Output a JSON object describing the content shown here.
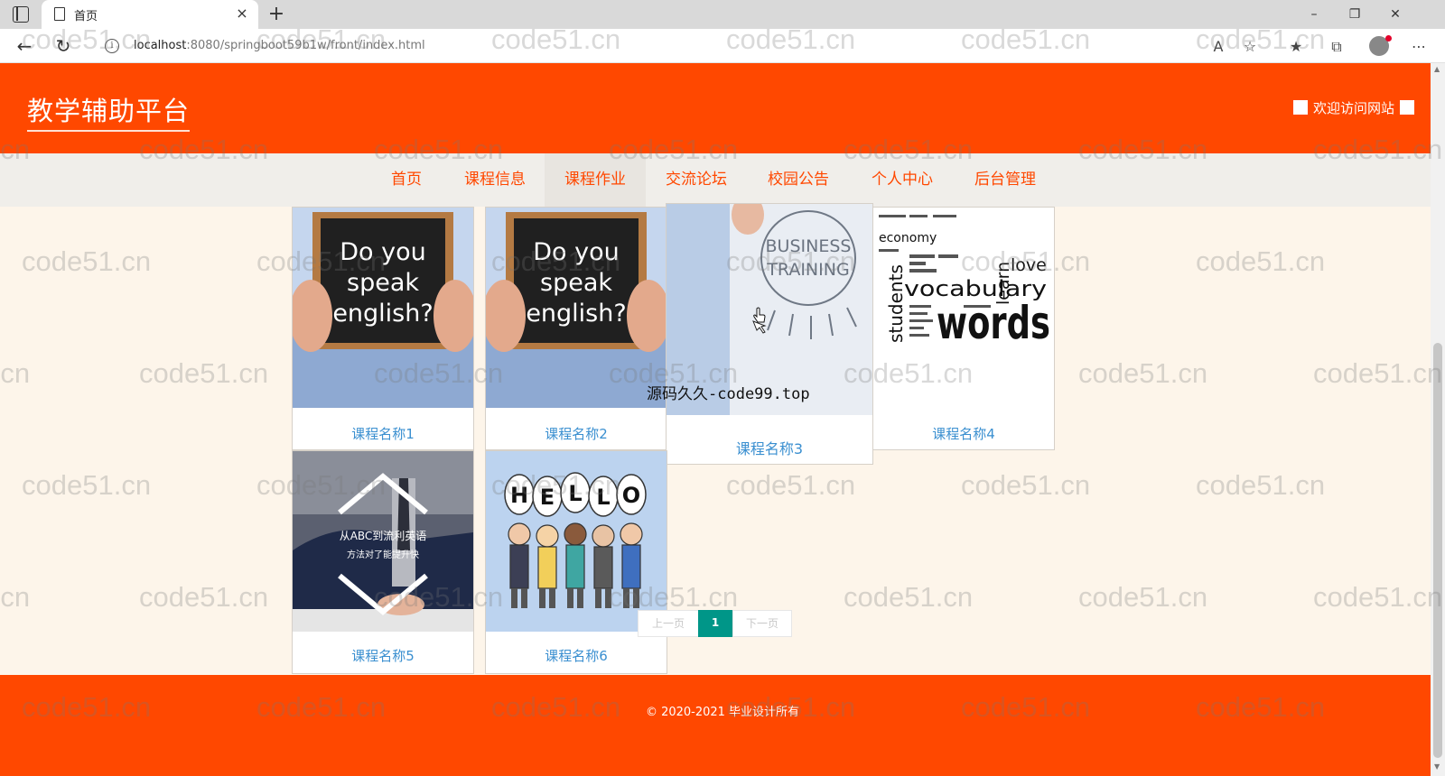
{
  "browser": {
    "tab_title": "首页",
    "tab_close": "×",
    "new_tab": "+",
    "url_host": "localhost",
    "url_rest": ":8080/springboot59b1w/front/index.html",
    "controls": {
      "minimize": "–",
      "restore": "❐",
      "close": "✕"
    }
  },
  "header": {
    "site_title": "教学辅助平台",
    "welcome": "欢迎访问网站"
  },
  "nav": {
    "items": [
      {
        "label": "首页"
      },
      {
        "label": "课程信息"
      },
      {
        "label": "课程作业"
      },
      {
        "label": "交流论坛"
      },
      {
        "label": "校园公告"
      },
      {
        "label": "个人中心"
      },
      {
        "label": "后台管理"
      }
    ],
    "active_index": 2
  },
  "courses": [
    {
      "name": "课程名称1",
      "image": "chalkboard-do-you-speak-english",
      "img_text": [
        "Do you",
        "speak",
        "english?"
      ]
    },
    {
      "name": "课程名称2",
      "image": "chalkboard-do-you-speak-english",
      "img_text": [
        "Do you",
        "speak",
        "english?"
      ]
    },
    {
      "name": "课程名称3",
      "image": "business-training-sketch",
      "img_text": [
        "BUSINESS",
        "TRAINING"
      ]
    },
    {
      "name": "课程名称4",
      "image": "english-word-cloud",
      "img_text": [
        "vocabulary",
        "words",
        "students",
        "learn",
        "love",
        "economy"
      ]
    },
    {
      "name": "课程名称5",
      "image": "student-writing-abc",
      "img_text": [
        "从ABC到流利英语",
        "方法对了能提升快"
      ]
    },
    {
      "name": "课程名称6",
      "image": "hello-kids-cartoon",
      "img_text": [
        "H",
        "E",
        "L",
        "L",
        "O"
      ]
    }
  ],
  "overlay_text": "源码久久-code99.top",
  "pagination": {
    "prev": "上一页",
    "current": "1",
    "next": "下一页"
  },
  "footer": {
    "copyright": "© 2020-2021 毕业设计所有"
  },
  "watermark": "code51.cn",
  "colors": {
    "brand": "#ff4800",
    "nav_bg": "#f0eeea",
    "page_bg": "#fdf5ea",
    "link": "#3a8fd0",
    "pager_active": "#009688"
  }
}
